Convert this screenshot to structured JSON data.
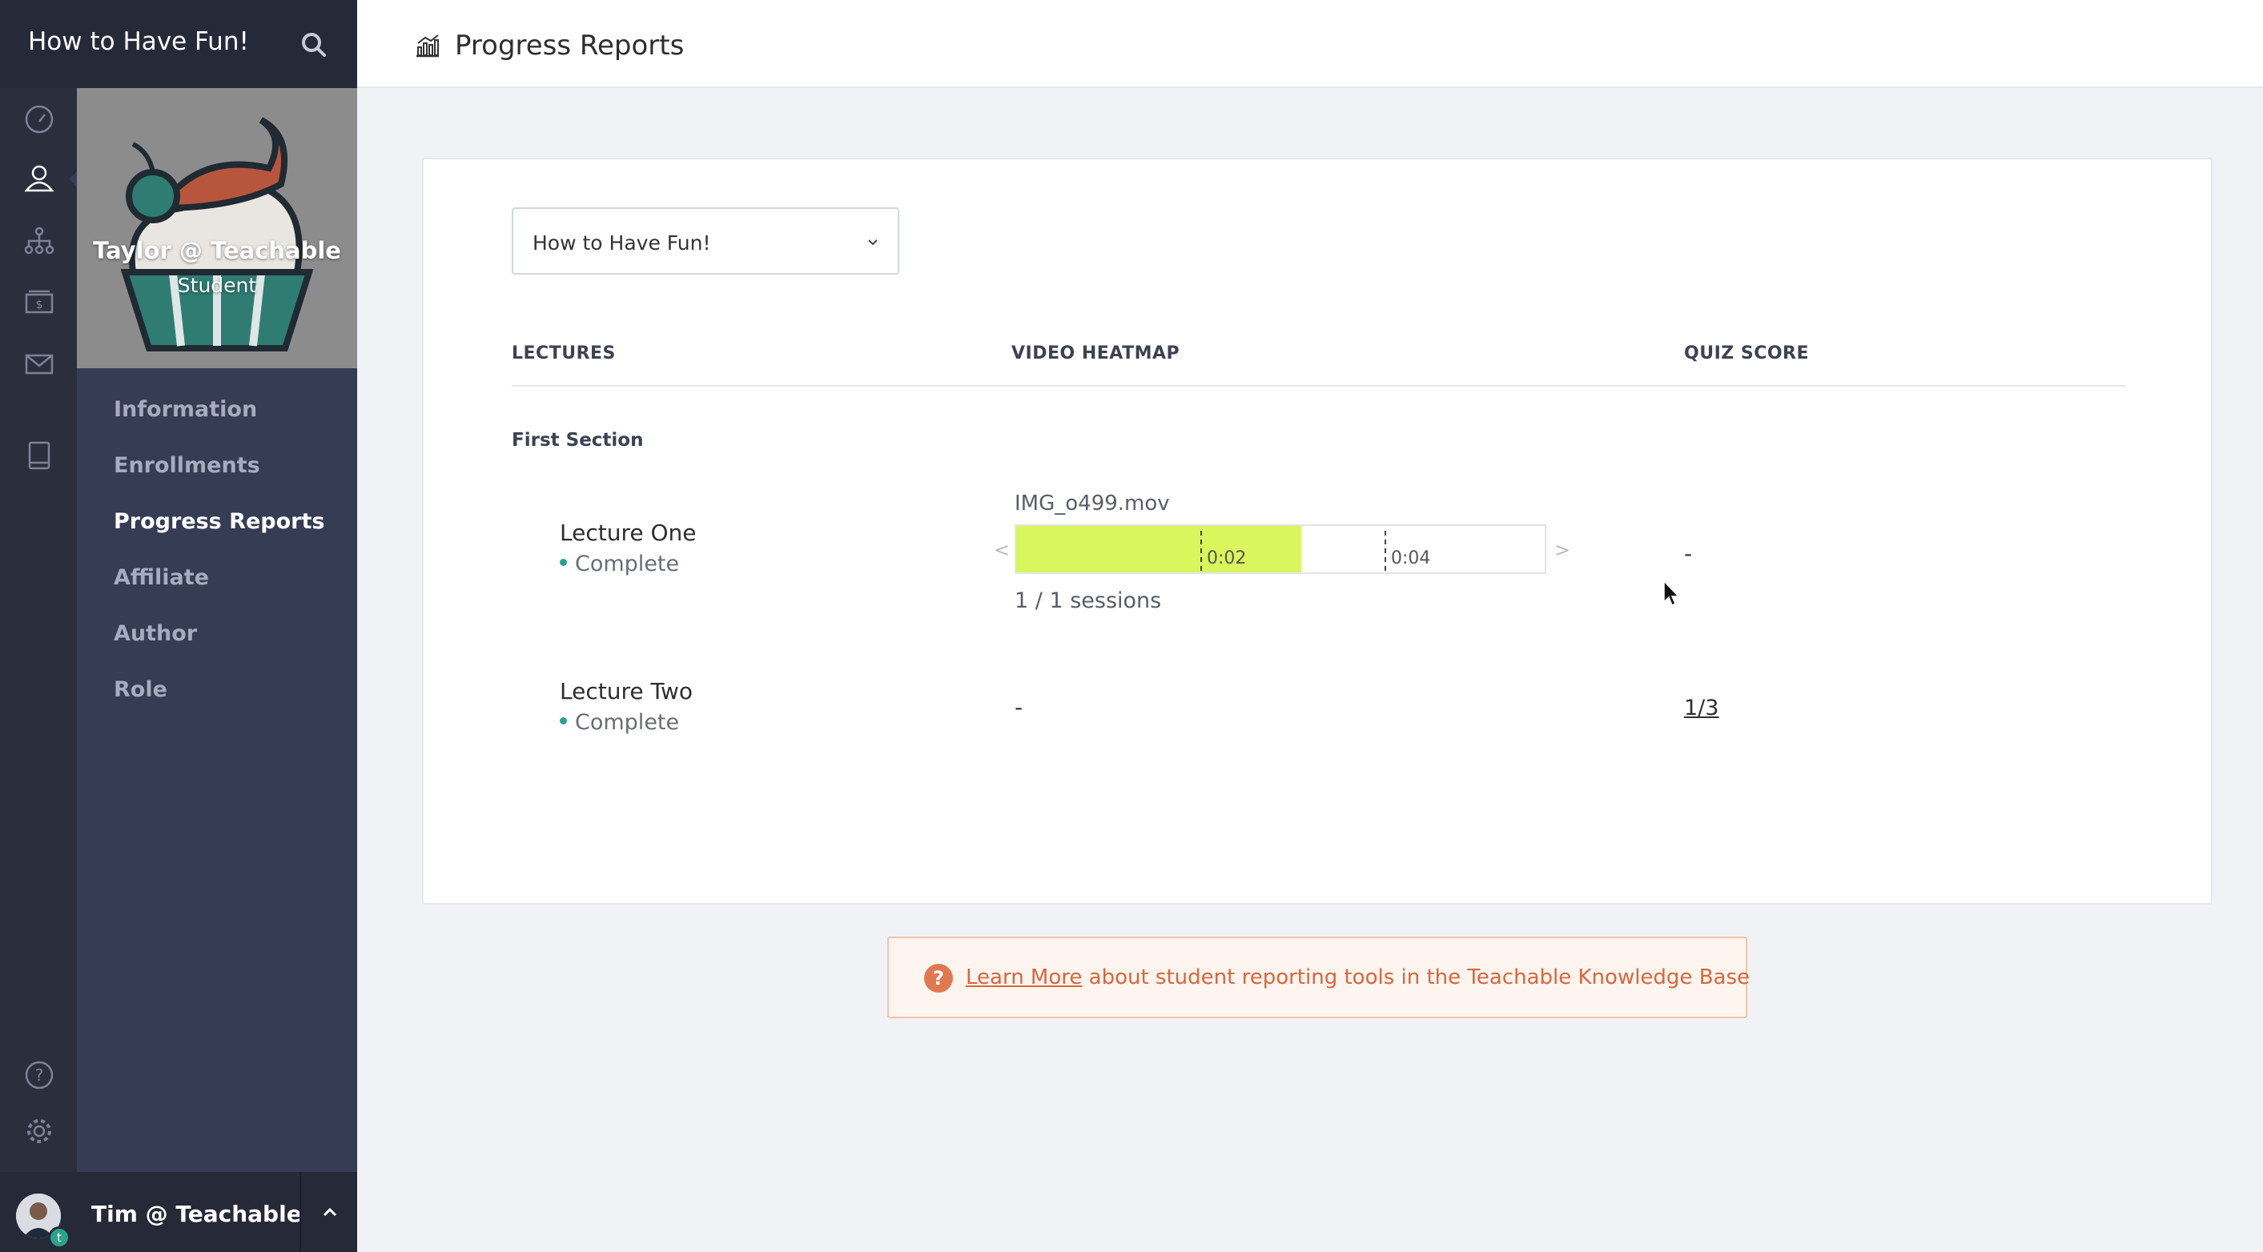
{
  "app": {
    "title": "How to Have Fun!"
  },
  "sidebar": {
    "profile": {
      "name": "Taylor @ Teachable",
      "role": "Student"
    },
    "items": [
      {
        "label": "Information",
        "active": false
      },
      {
        "label": "Enrollments",
        "active": false
      },
      {
        "label": "Progress Reports",
        "active": true
      },
      {
        "label": "Affiliate",
        "active": false
      },
      {
        "label": "Author",
        "active": false
      },
      {
        "label": "Role",
        "active": false
      }
    ],
    "rail_icons": [
      "dashboard-icon",
      "users-icon",
      "sitemap-icon",
      "sales-icon",
      "mail-icon",
      "book-icon",
      "help-icon",
      "gear-icon"
    ]
  },
  "user": {
    "name": "Tim @ Teachable",
    "badge": "t"
  },
  "header": {
    "title": "Progress Reports"
  },
  "report": {
    "course_select": "How to Have Fun!",
    "columns": {
      "lectures": "LECTURES",
      "heatmap": "VIDEO HEATMAP",
      "quiz": "QUIZ SCORE"
    },
    "section": "First Section",
    "lectures": [
      {
        "name": "Lecture One",
        "status": "Complete",
        "video": {
          "file": "IMG_o499.mov",
          "watched_fraction": 0.54,
          "ticks": [
            "0:02",
            "0:04"
          ],
          "prev": "<",
          "next": ">",
          "sessions": "1 / 1 sessions"
        },
        "quiz": "-"
      },
      {
        "name": "Lecture Two",
        "status": "Complete",
        "video_text": "-",
        "quiz": "1/3"
      }
    ]
  },
  "help": {
    "link": "Learn More",
    "text": " about student reporting tools in the Teachable Knowledge Base",
    "icon": "?"
  },
  "colors": {
    "accent": "#2aa389",
    "heat": "#dbf55c",
    "help": "#d9663a"
  }
}
